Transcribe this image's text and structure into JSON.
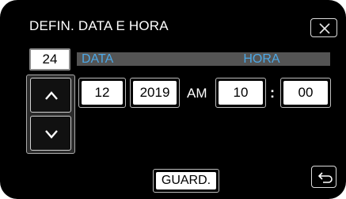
{
  "header": {
    "title": "DEFIN. DATA E HORA",
    "close_icon": "close-icon"
  },
  "day": {
    "value": "24"
  },
  "columns": {
    "date_label": "DATA",
    "time_label": "HORA"
  },
  "date": {
    "month": "12",
    "year": "2019"
  },
  "time": {
    "ampm": "AM",
    "hour": "10",
    "separator": ":",
    "minute": "00"
  },
  "arrows": {
    "up_icon": "chevron-up-icon",
    "down_icon": "chevron-down-icon"
  },
  "footer": {
    "save_label": "GUARD.",
    "back_icon": "return-icon"
  },
  "colors": {
    "background": "#000000",
    "accent_text": "#4da8e6",
    "header_bar": "#545454",
    "field_bg": "#ffffff"
  }
}
